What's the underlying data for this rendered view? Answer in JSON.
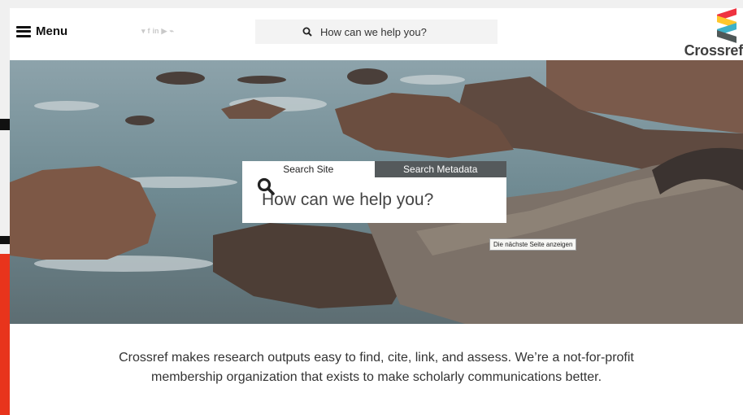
{
  "header": {
    "menu_label": "Menu",
    "social_icons": [
      "twitter-icon",
      "facebook-icon",
      "linkedin-icon",
      "youtube-icon",
      "rss-icon"
    ],
    "social_glyphs": [
      "▾",
      "f",
      "in",
      "▶",
      "⌁"
    ],
    "search_placeholder": "How can we help you?",
    "logo_text": "Crossref",
    "logo_colors": [
      "#ef3340",
      "#ffc72c",
      "#3eb1c8",
      "#4f5858"
    ]
  },
  "hero": {
    "tabs": [
      {
        "label": "Search Site",
        "active": true
      },
      {
        "label": "Search Metadata",
        "active": false
      }
    ],
    "search_placeholder": "How can we help you?",
    "tooltip": "Die nächste Seite anzeigen"
  },
  "tagline": {
    "text": "Crossref makes research outputs easy to find, cite, link, and assess. We’re a not-for-profit membership organization that exists to make scholarly communications better."
  }
}
